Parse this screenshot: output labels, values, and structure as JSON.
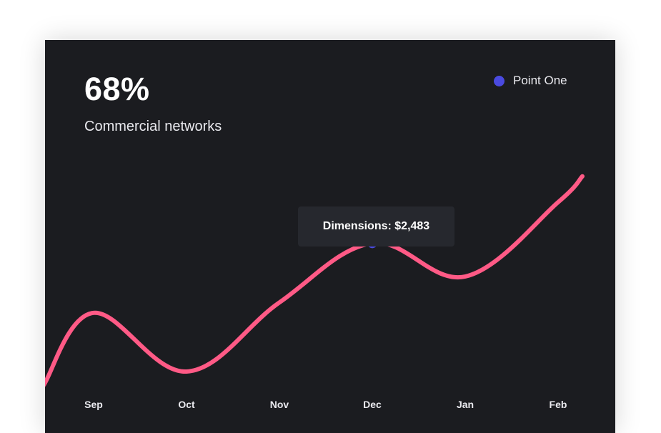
{
  "card": {
    "headline": "68%",
    "subhead": "Commercial networks",
    "background": "#1b1c20"
  },
  "tooltip": {
    "label": "Dimensions:",
    "value": "$2,483"
  },
  "chart_data": {
    "type": "line",
    "categories": [
      "Sep",
      "Oct",
      "Nov",
      "Dec",
      "Jan",
      "Feb"
    ],
    "series": [
      {
        "name": "Point One",
        "color": "#ff5a86",
        "values": [
          2080,
          1740,
          2140,
          2483,
          2290,
          2720
        ]
      }
    ],
    "highlight": {
      "category": "Dec",
      "value": 2483,
      "color": "#4a4ae0"
    },
    "legend": {
      "placement": "top-right",
      "marker_color": "#4a4ae0"
    },
    "grid": false,
    "y_axis_visible": false
  }
}
